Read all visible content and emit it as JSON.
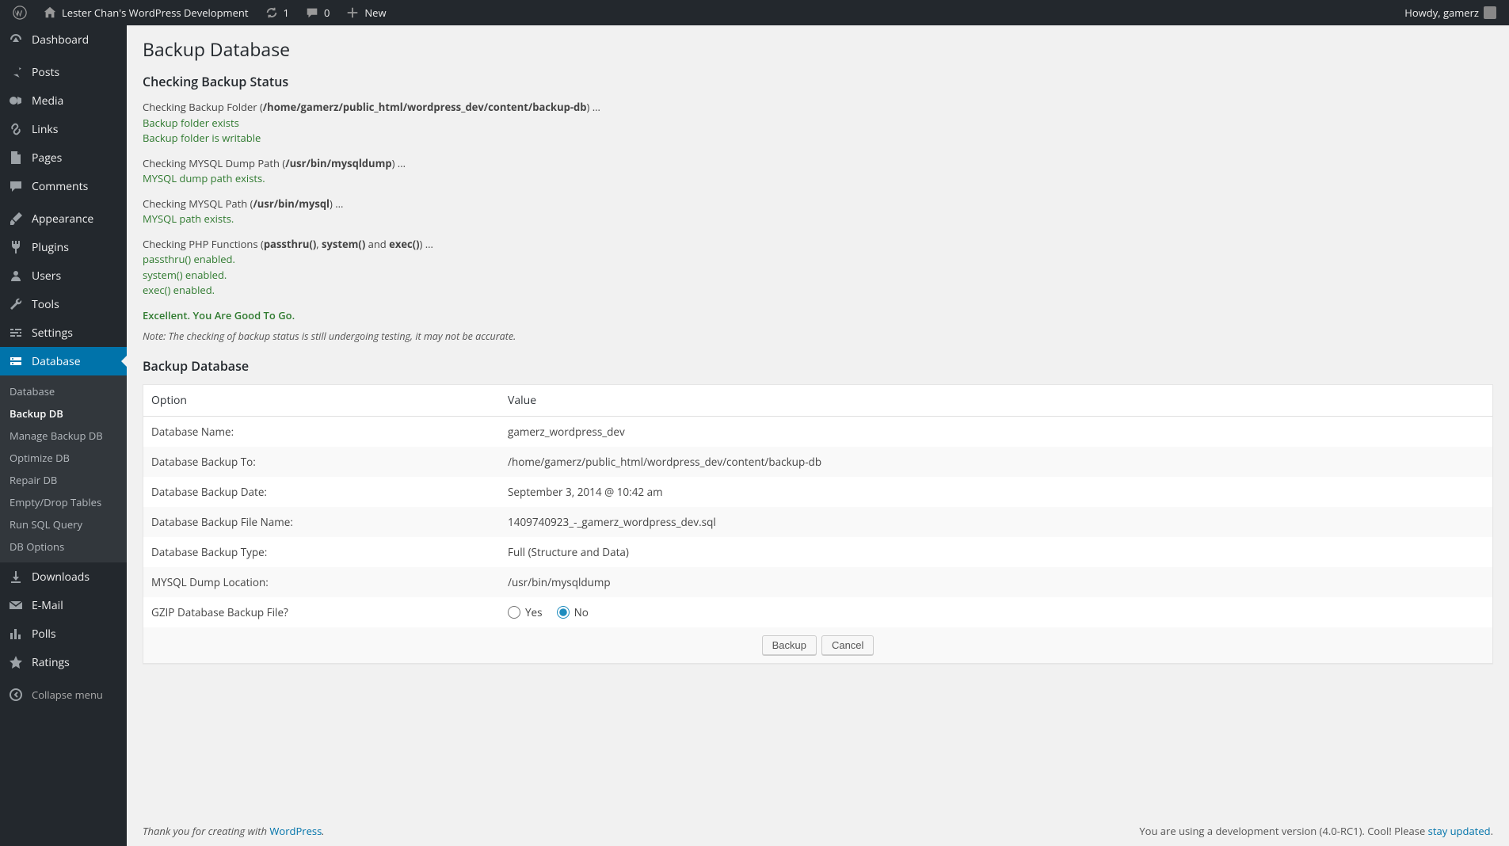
{
  "adminbar": {
    "site_title": "Lester Chan's WordPress Development",
    "updates_count": "1",
    "comments_count": "0",
    "new_label": "New",
    "howdy": "Howdy, gamerz"
  },
  "sidebar": {
    "items": [
      {
        "label": "Dashboard",
        "icon": "dashboard"
      },
      {
        "label": "Posts",
        "icon": "pin"
      },
      {
        "label": "Media",
        "icon": "media"
      },
      {
        "label": "Links",
        "icon": "link"
      },
      {
        "label": "Pages",
        "icon": "page"
      },
      {
        "label": "Comments",
        "icon": "comment"
      },
      {
        "label": "Appearance",
        "icon": "brush"
      },
      {
        "label": "Plugins",
        "icon": "plug"
      },
      {
        "label": "Users",
        "icon": "users"
      },
      {
        "label": "Tools",
        "icon": "wrench"
      },
      {
        "label": "Settings",
        "icon": "sliders"
      },
      {
        "label": "Database",
        "icon": "database"
      },
      {
        "label": "Downloads",
        "icon": "download"
      },
      {
        "label": "E-Mail",
        "icon": "mail"
      },
      {
        "label": "Polls",
        "icon": "chart"
      },
      {
        "label": "Ratings",
        "icon": "star"
      }
    ],
    "submenu": [
      {
        "label": "Database"
      },
      {
        "label": "Backup DB"
      },
      {
        "label": "Manage Backup DB"
      },
      {
        "label": "Optimize DB"
      },
      {
        "label": "Repair DB"
      },
      {
        "label": "Empty/Drop Tables"
      },
      {
        "label": "Run SQL Query"
      },
      {
        "label": "DB Options"
      }
    ],
    "collapse": "Collapse menu"
  },
  "page": {
    "title": "Backup Database",
    "status_heading": "Checking Backup Status",
    "checks": [
      {
        "prefix": "Checking Backup Folder (",
        "bold": "/home/gamerz/public_html/wordpress_dev/content/backup-db",
        "suffix": ") ...",
        "results": [
          "Backup folder exists",
          "Backup folder is writable"
        ]
      },
      {
        "prefix": "Checking MYSQL Dump Path (",
        "bold": "/usr/bin/mysqldump",
        "suffix": ") ...",
        "results": [
          "MYSQL dump path exists."
        ]
      },
      {
        "prefix": "Checking MYSQL Path (",
        "bold": "/usr/bin/mysql",
        "suffix": ") ...",
        "results": [
          "MYSQL path exists."
        ]
      }
    ],
    "php_check": {
      "prefix": "Checking PHP Functions (",
      "b1": "passthru()",
      "mid1": ", ",
      "b2": "system()",
      "mid2": " and ",
      "b3": "exec()",
      "suffix": ") ...",
      "results": [
        "passthru() enabled.",
        "system() enabled.",
        "exec() enabled."
      ]
    },
    "excellent": "Excellent. You Are Good To Go.",
    "note": "Note: The checking of backup status is still undergoing testing, it may not be accurate.",
    "form_heading": "Backup Database",
    "table": {
      "head_option": "Option",
      "head_value": "Value",
      "rows": [
        {
          "opt": "Database Name:",
          "val": "gamerz_wordpress_dev"
        },
        {
          "opt": "Database Backup To:",
          "val": "/home/gamerz/public_html/wordpress_dev/content/backup-db"
        },
        {
          "opt": "Database Backup Date:",
          "val": "September 3, 2014 @ 10:42 am"
        },
        {
          "opt": "Database Backup File Name:",
          "val": "1409740923_-_gamerz_wordpress_dev.sql"
        },
        {
          "opt": "Database Backup Type:",
          "val": "Full (Structure and Data)"
        },
        {
          "opt": "MYSQL Dump Location:",
          "val": "/usr/bin/mysqldump"
        }
      ],
      "gzip_opt": "GZIP Database Backup File?",
      "gzip_yes": "Yes",
      "gzip_no": "No",
      "btn_backup": "Backup",
      "btn_cancel": "Cancel"
    }
  },
  "footer": {
    "left_pre": "Thank you for creating with ",
    "left_link": "WordPress",
    "left_post": ".",
    "right_pre": "You are using a development version (4.0-RC1). Cool! Please ",
    "right_link": "stay updated",
    "right_post": "."
  }
}
